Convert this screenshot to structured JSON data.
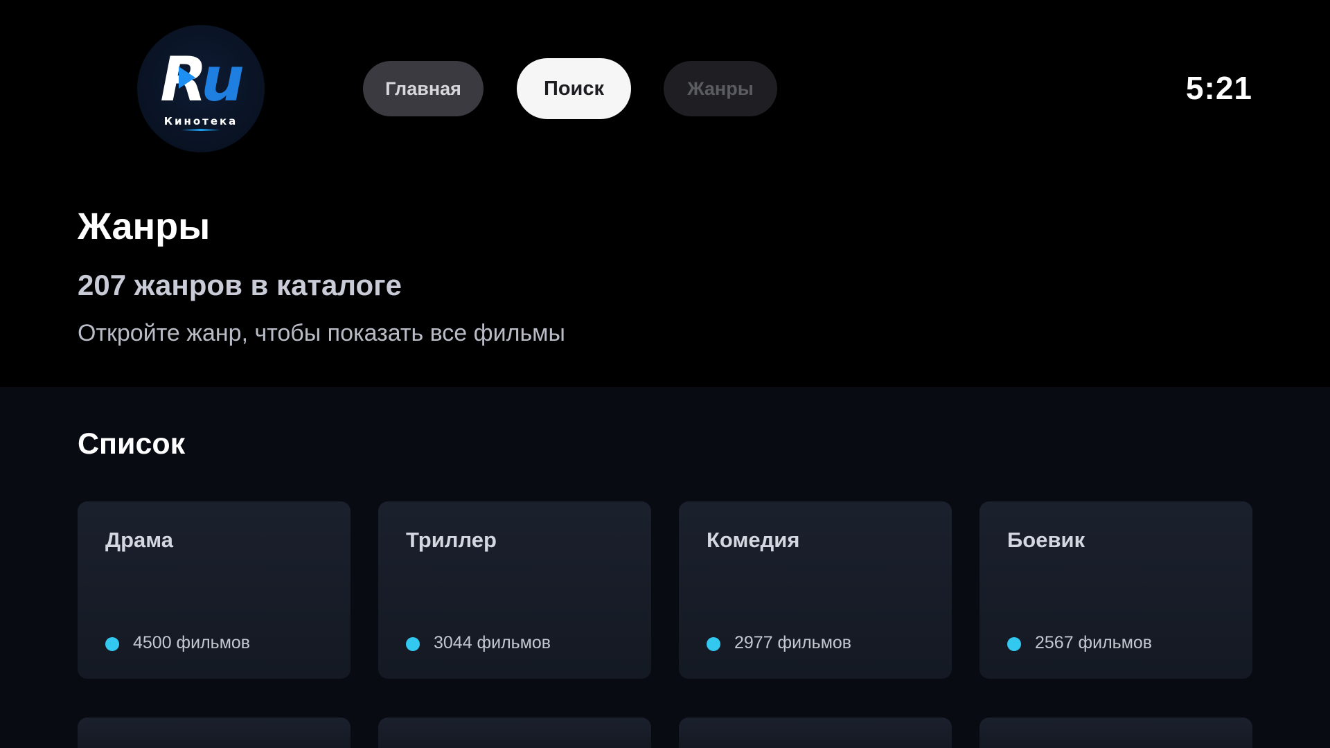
{
  "logo": {
    "mark_r": "R",
    "mark_u": "u",
    "subtitle": "Кинотека"
  },
  "nav": {
    "home": "Главная",
    "search": "Поиск",
    "genres": "Жанры"
  },
  "clock": "5:21",
  "page": {
    "title": "Жанры",
    "subtitle": "207 жанров в каталоге",
    "hint": "Откройте жанр, чтобы показать все фильмы"
  },
  "section": {
    "title": "Список"
  },
  "cards": [
    {
      "name": "Драма",
      "count": "4500 фильмов"
    },
    {
      "name": "Триллер",
      "count": "3044 фильмов"
    },
    {
      "name": "Комедия",
      "count": "2977 фильмов"
    },
    {
      "name": "Боевик",
      "count": "2567 фильмов"
    }
  ],
  "colors": {
    "accent_dot": "#33c8f0",
    "logo_blue": "#1e7fe0",
    "active_nav_bg": "#f6f6f6"
  }
}
